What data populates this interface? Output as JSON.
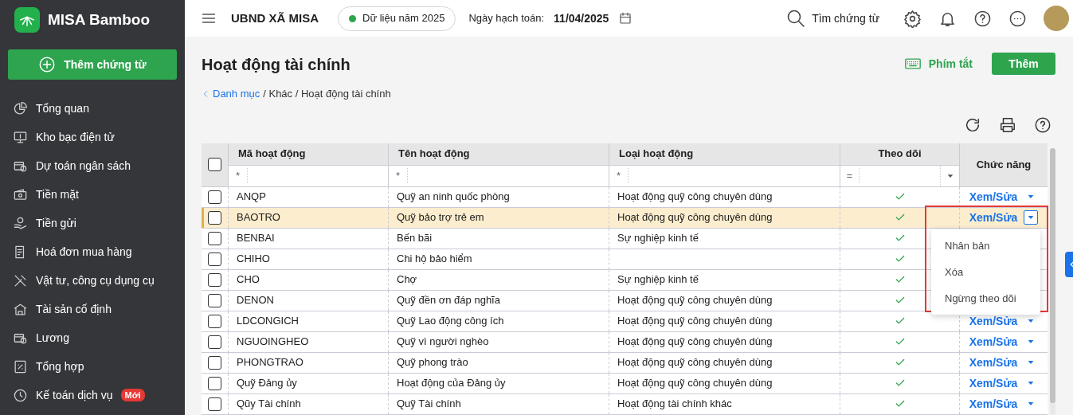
{
  "app": {
    "name": "MISA Bamboo",
    "add_button": "Thêm chứng từ"
  },
  "sidebar": {
    "items": [
      {
        "label": "Tổng quan"
      },
      {
        "label": "Kho bạc điện tử"
      },
      {
        "label": "Dự toán ngân sách"
      },
      {
        "label": "Tiền mặt"
      },
      {
        "label": "Tiền gửi"
      },
      {
        "label": "Hoá đơn mua hàng"
      },
      {
        "label": "Vật tư, công cụ dụng cụ"
      },
      {
        "label": "Tài sản cố định"
      },
      {
        "label": "Lương"
      },
      {
        "label": "Tổng hợp"
      },
      {
        "label": "Kế toán dịch vụ",
        "badge": "Mới"
      }
    ]
  },
  "topbar": {
    "org": "UBND XÃ MISA",
    "data_year": "Dữ liệu năm 2025",
    "date_label": "Ngày hạch toán:",
    "date": "11/04/2025",
    "search": "Tìm chứng từ"
  },
  "page": {
    "title": "Hoạt động tài chính",
    "breadcrumb": [
      {
        "label": "Danh mục",
        "kind": "link"
      },
      {
        "label": "/ Khác / Hoạt động tài chính",
        "kind": "text"
      }
    ],
    "shortcut_button": "Phím tắt",
    "add_button": "Thêm"
  },
  "table": {
    "select_all": {
      "checked": false
    },
    "columns": [
      {
        "label": "Mã hoạt động",
        "filter": "*"
      },
      {
        "label": "Tên hoạt động",
        "filter": "*"
      },
      {
        "label": "Loại hoạt động",
        "filter": "*"
      },
      {
        "label": "Theo dõi",
        "filter": "="
      },
      {
        "label": "Chức năng"
      }
    ],
    "rows": [
      {
        "checked": false,
        "selected": false,
        "code": "ANQP",
        "name": "Quỹ an ninh quốc phòng",
        "type": "Hoạt động quỹ công chuyên dùng",
        "tracked": true,
        "action": "Xem/Sửa",
        "menu_open": false
      },
      {
        "checked": false,
        "selected": true,
        "code": "BAOTRO",
        "name": "Quỹ bảo trợ trẻ em",
        "type": "Hoạt động quỹ công chuyên dùng",
        "tracked": true,
        "action": "Xem/Sửa",
        "menu_open": true
      },
      {
        "checked": false,
        "selected": false,
        "code": "BENBAI",
        "name": "Bến bãi",
        "type": "Sự nghiệp kinh tế",
        "tracked": true
      },
      {
        "checked": false,
        "selected": false,
        "code": "CHIHO",
        "name": "Chi hộ bảo hiểm",
        "tracked": true
      },
      {
        "checked": false,
        "selected": false,
        "code": "CHO",
        "name": "Chợ",
        "type": "Sự nghiệp kinh tế",
        "tracked": true
      },
      {
        "checked": false,
        "selected": false,
        "code": "DENON",
        "name": "Quỹ đền ơn đáp nghĩa",
        "type": "Hoạt động quỹ công chuyên dùng",
        "tracked": true
      },
      {
        "checked": false,
        "selected": false,
        "code": "LDCONGICH",
        "name": "Quỹ Lao động công ích",
        "type": "Hoạt động quỹ công chuyên dùng",
        "tracked": true,
        "action": "Xem/Sửa",
        "menu_open": false
      },
      {
        "checked": false,
        "selected": false,
        "code": "NGUOINGHEO",
        "name": "Quỹ vì người nghèo",
        "type": "Hoạt động quỹ công chuyên dùng",
        "tracked": true,
        "action": "Xem/Sửa",
        "menu_open": false
      },
      {
        "checked": false,
        "selected": false,
        "code": "PHONGTRAO",
        "name": "Quỹ phong trào",
        "type": "Hoạt động quỹ công chuyên dùng",
        "tracked": true,
        "action": "Xem/Sửa",
        "menu_open": false
      },
      {
        "checked": false,
        "selected": false,
        "code": "Quỹ Đảng ủy",
        "name": "Hoạt động của Đảng ủy",
        "type": "Hoạt động quỹ công chuyên dùng",
        "tracked": true,
        "action": "Xem/Sửa",
        "menu_open": false
      },
      {
        "checked": false,
        "selected": false,
        "code": "Qũy Tài chính",
        "name": "Quỹ Tài chính",
        "type": "Hoạt động tài chính khác",
        "tracked": true,
        "action": "Xem/Sửa",
        "menu_open": false
      }
    ]
  },
  "action_menu": {
    "items": [
      "Nhân bản",
      "Xóa",
      "Ngừng theo dõi"
    ]
  }
}
